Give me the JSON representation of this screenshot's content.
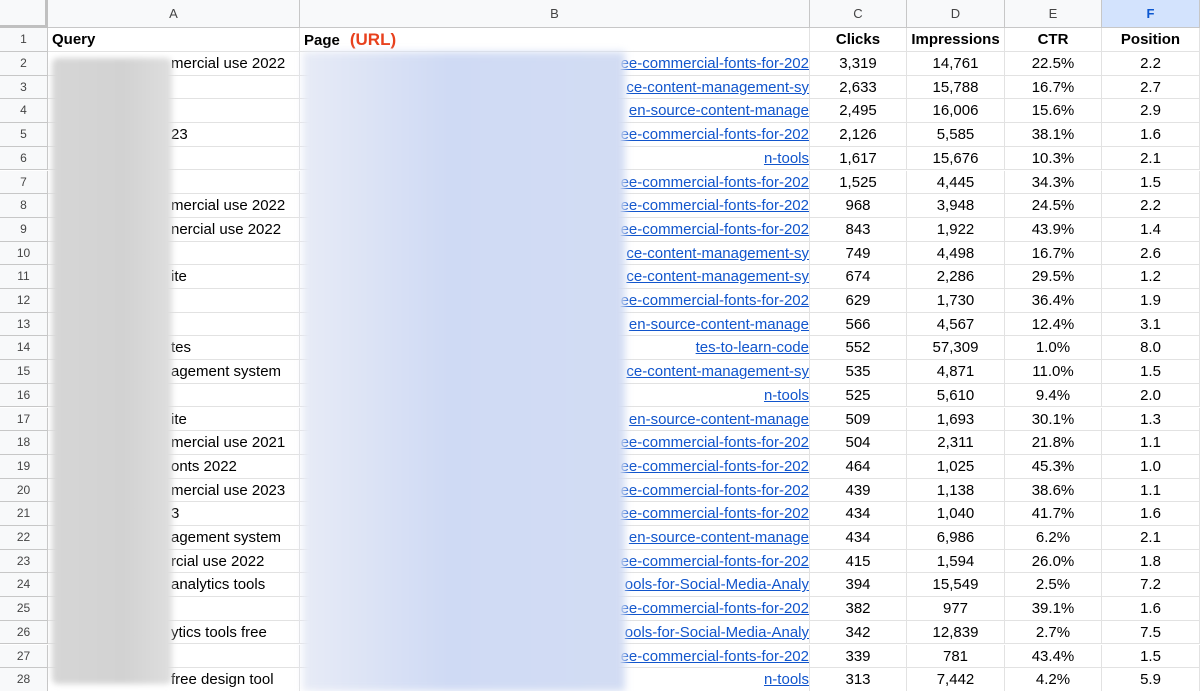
{
  "columns": [
    "A",
    "B",
    "C",
    "D",
    "E",
    "F"
  ],
  "selected_column": "F",
  "header": {
    "row_number": "1",
    "query": "Query",
    "page": "Page",
    "url_tag": "(URL)",
    "clicks": "Clicks",
    "impressions": "Impressions",
    "ctr": "CTR",
    "position": "Position"
  },
  "rows": [
    {
      "n": "2",
      "query": "mercial use 2022",
      "page": "ee-commercial-fonts-for-202",
      "clicks": "3,319",
      "impressions": "14,761",
      "ctr": "22.5%",
      "position": "2.2"
    },
    {
      "n": "3",
      "query": "",
      "page": "ce-content-management-sy",
      "clicks": "2,633",
      "impressions": "15,788",
      "ctr": "16.7%",
      "position": "2.7"
    },
    {
      "n": "4",
      "query": "",
      "page": "en-source-content-manage",
      "clicks": "2,495",
      "impressions": "16,006",
      "ctr": "15.6%",
      "position": "2.9"
    },
    {
      "n": "5",
      "query": "23",
      "page": "ee-commercial-fonts-for-202",
      "clicks": "2,126",
      "impressions": "5,585",
      "ctr": "38.1%",
      "position": "1.6"
    },
    {
      "n": "6",
      "query": "",
      "page": "n-tools",
      "clicks": "1,617",
      "impressions": "15,676",
      "ctr": "10.3%",
      "position": "2.1"
    },
    {
      "n": "7",
      "query": "",
      "page": "ee-commercial-fonts-for-202",
      "clicks": "1,525",
      "impressions": "4,445",
      "ctr": "34.3%",
      "position": "1.5"
    },
    {
      "n": "8",
      "query": "mercial use 2022",
      "page": "ee-commercial-fonts-for-202",
      "clicks": "968",
      "impressions": "3,948",
      "ctr": "24.5%",
      "position": "2.2"
    },
    {
      "n": "9",
      "query": "nercial use 2022",
      "page": "ee-commercial-fonts-for-202",
      "clicks": "843",
      "impressions": "1,922",
      "ctr": "43.9%",
      "position": "1.4"
    },
    {
      "n": "10",
      "query": "",
      "page": "ce-content-management-sy",
      "clicks": "749",
      "impressions": "4,498",
      "ctr": "16.7%",
      "position": "2.6"
    },
    {
      "n": "11",
      "query": "ite",
      "page": "ce-content-management-sy",
      "clicks": "674",
      "impressions": "2,286",
      "ctr": "29.5%",
      "position": "1.2"
    },
    {
      "n": "12",
      "query": "",
      "page": "ee-commercial-fonts-for-202",
      "clicks": "629",
      "impressions": "1,730",
      "ctr": "36.4%",
      "position": "1.9"
    },
    {
      "n": "13",
      "query": "",
      "page": "en-source-content-manage",
      "clicks": "566",
      "impressions": "4,567",
      "ctr": "12.4%",
      "position": "3.1"
    },
    {
      "n": "14",
      "query": "tes",
      "page": "tes-to-learn-code",
      "clicks": "552",
      "impressions": "57,309",
      "ctr": "1.0%",
      "position": "8.0"
    },
    {
      "n": "15",
      "query": "agement system",
      "page": "ce-content-management-sy",
      "clicks": "535",
      "impressions": "4,871",
      "ctr": "11.0%",
      "position": "1.5"
    },
    {
      "n": "16",
      "query": "",
      "page": "n-tools",
      "clicks": "525",
      "impressions": "5,610",
      "ctr": "9.4%",
      "position": "2.0"
    },
    {
      "n": "17",
      "query": "ite",
      "page": "en-source-content-manage",
      "clicks": "509",
      "impressions": "1,693",
      "ctr": "30.1%",
      "position": "1.3"
    },
    {
      "n": "18",
      "query": "mercial use 2021",
      "page": "ee-commercial-fonts-for-202",
      "clicks": "504",
      "impressions": "2,311",
      "ctr": "21.8%",
      "position": "1.1"
    },
    {
      "n": "19",
      "query": "onts 2022",
      "page": "ee-commercial-fonts-for-202",
      "clicks": "464",
      "impressions": "1,025",
      "ctr": "45.3%",
      "position": "1.0"
    },
    {
      "n": "20",
      "query": "mercial use 2023",
      "page": "ee-commercial-fonts-for-202",
      "clicks": "439",
      "impressions": "1,138",
      "ctr": "38.6%",
      "position": "1.1"
    },
    {
      "n": "21",
      "query": "3",
      "page": "ee-commercial-fonts-for-202",
      "clicks": "434",
      "impressions": "1,040",
      "ctr": "41.7%",
      "position": "1.6"
    },
    {
      "n": "22",
      "query": "agement system",
      "page": "en-source-content-manage",
      "clicks": "434",
      "impressions": "6,986",
      "ctr": "6.2%",
      "position": "2.1"
    },
    {
      "n": "23",
      "query": "rcial use 2022",
      "page": "ee-commercial-fonts-for-202",
      "clicks": "415",
      "impressions": "1,594",
      "ctr": "26.0%",
      "position": "1.8"
    },
    {
      "n": "24",
      "query": "analytics tools",
      "page": "ools-for-Social-Media-Analy",
      "clicks": "394",
      "impressions": "15,549",
      "ctr": "2.5%",
      "position": "7.2"
    },
    {
      "n": "25",
      "query": "",
      "page": "ee-commercial-fonts-for-202",
      "clicks": "382",
      "impressions": "977",
      "ctr": "39.1%",
      "position": "1.6"
    },
    {
      "n": "26",
      "query": "ytics tools free",
      "page": "ools-for-Social-Media-Analy",
      "clicks": "342",
      "impressions": "12,839",
      "ctr": "2.7%",
      "position": "7.5"
    },
    {
      "n": "27",
      "query": "",
      "page": "ee-commercial-fonts-for-202",
      "clicks": "339",
      "impressions": "781",
      "ctr": "43.4%",
      "position": "1.5"
    },
    {
      "n": "28",
      "query": "free design tool",
      "page": "n-tools",
      "clicks": "313",
      "impressions": "7,442",
      "ctr": "4.2%",
      "position": "5.9"
    }
  ]
}
